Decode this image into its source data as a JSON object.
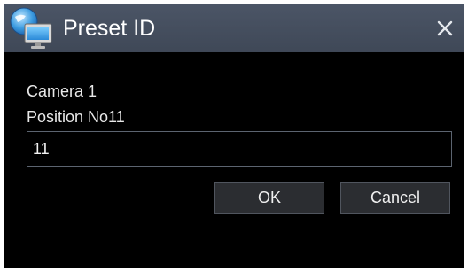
{
  "window": {
    "title": "Preset ID",
    "app_icon": "network-computer-icon",
    "close_icon": "close-icon"
  },
  "form": {
    "camera_label": "Camera 1",
    "position_label": "Position No11",
    "preset_value": "11"
  },
  "buttons": {
    "ok_label": "OK",
    "cancel_label": "Cancel"
  },
  "colors": {
    "titlebar": "#444d5c",
    "background": "#000000",
    "text": "#e8e8e8",
    "button": "#2b2d31",
    "border": "#5c6470"
  }
}
